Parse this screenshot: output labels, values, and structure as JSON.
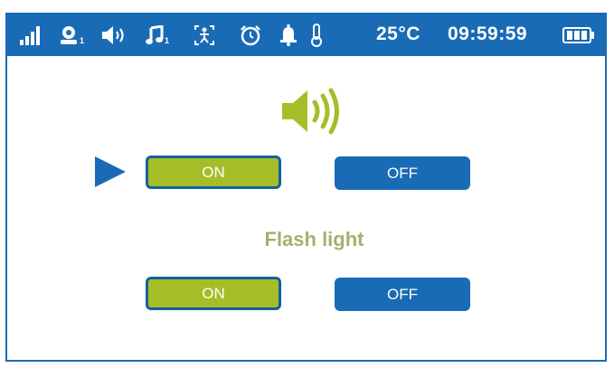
{
  "status_bar": {
    "icons": [
      "signal-icon",
      "baby-unit-icon",
      "speaker-icon",
      "music-note-icon",
      "motion-icon",
      "alarm-clock-icon",
      "bell-icon",
      "thermometer-icon",
      "battery-icon"
    ],
    "baby_unit_index": "1",
    "music_index": "1",
    "temperature": "25°C",
    "time": "09:59:59"
  },
  "sound_section": {
    "icon": "speaker-icon",
    "on_label": "ON",
    "off_label": "OFF",
    "selected": "ON"
  },
  "flash_section": {
    "title": "Flash light",
    "on_label": "ON",
    "off_label": "OFF",
    "selected": "ON"
  },
  "colors": {
    "blue": "#1a6bb5",
    "green": "#a7bd28",
    "label": "#a9ae6f"
  }
}
